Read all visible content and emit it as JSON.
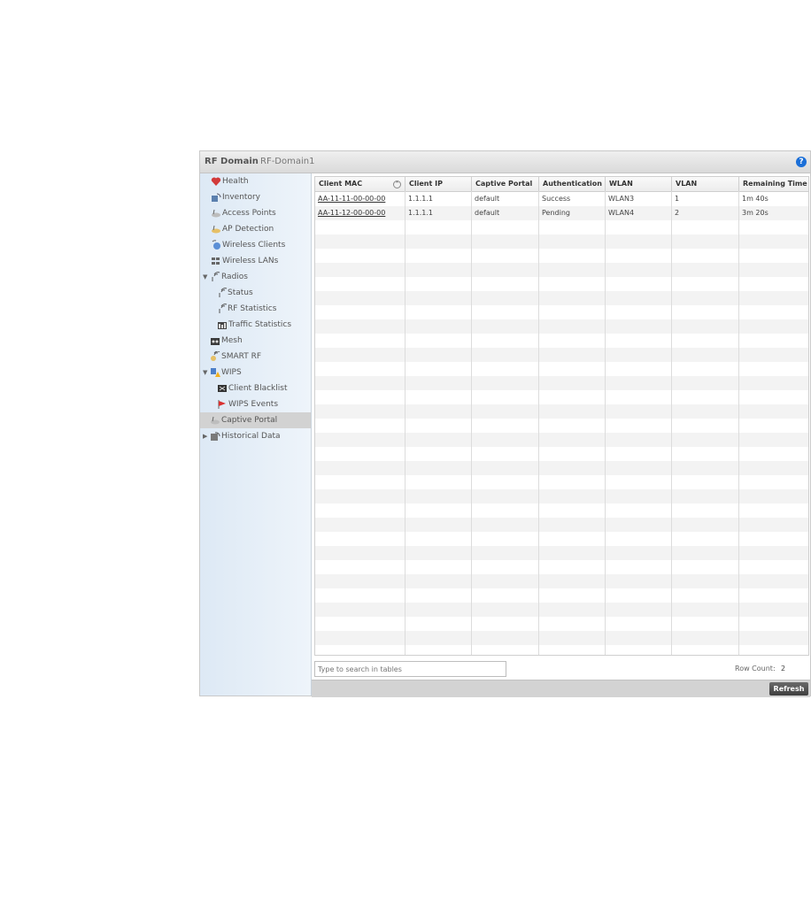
{
  "header": {
    "title": "RF Domain",
    "subtitle": "RF-Domain1",
    "help_label": "?"
  },
  "sidebar": {
    "items": [
      {
        "label": "Health",
        "icon": "health-icon"
      },
      {
        "label": "Inventory",
        "icon": "inventory-icon"
      },
      {
        "label": "Access Points",
        "icon": "access-point-icon"
      },
      {
        "label": "AP Detection",
        "icon": "ap-detection-icon"
      },
      {
        "label": "Wireless Clients",
        "icon": "wireless-clients-icon"
      },
      {
        "label": "Wireless LANs",
        "icon": "wireless-lans-icon"
      },
      {
        "label": "Radios",
        "icon": "radio-icon"
      },
      {
        "label": "Status",
        "icon": "radio-status-icon"
      },
      {
        "label": "RF Statistics",
        "icon": "rf-statistics-icon"
      },
      {
        "label": "Traffic Statistics",
        "icon": "traffic-statistics-icon"
      },
      {
        "label": "Mesh",
        "icon": "mesh-icon"
      },
      {
        "label": "SMART RF",
        "icon": "smart-rf-icon"
      },
      {
        "label": "WIPS",
        "icon": "wips-icon"
      },
      {
        "label": "Client Blacklist",
        "icon": "client-blacklist-icon"
      },
      {
        "label": "WIPS Events",
        "icon": "wips-events-icon"
      },
      {
        "label": "Captive Portal",
        "icon": "captive-portal-icon",
        "selected": true
      },
      {
        "label": "Historical Data",
        "icon": "historical-data-icon"
      }
    ]
  },
  "table": {
    "columns": [
      "Client MAC",
      "Client IP",
      "Captive Portal",
      "Authentication",
      "WLAN",
      "VLAN",
      "Remaining Time"
    ],
    "rows": [
      [
        "AA-11-11-00-00-00",
        "1.1.1.1",
        "default",
        "Success",
        "WLAN3",
        "1",
        "1m 40s"
      ],
      [
        "AA-11-12-00-00-00",
        "1.1.1.1",
        "default",
        "Pending",
        "WLAN4",
        "2",
        "3m 20s"
      ]
    ]
  },
  "search": {
    "placeholder": "Type to search in tables"
  },
  "row_count": {
    "label": "Row Count:",
    "value": "2"
  },
  "footer": {
    "refresh_label": "Refresh"
  }
}
